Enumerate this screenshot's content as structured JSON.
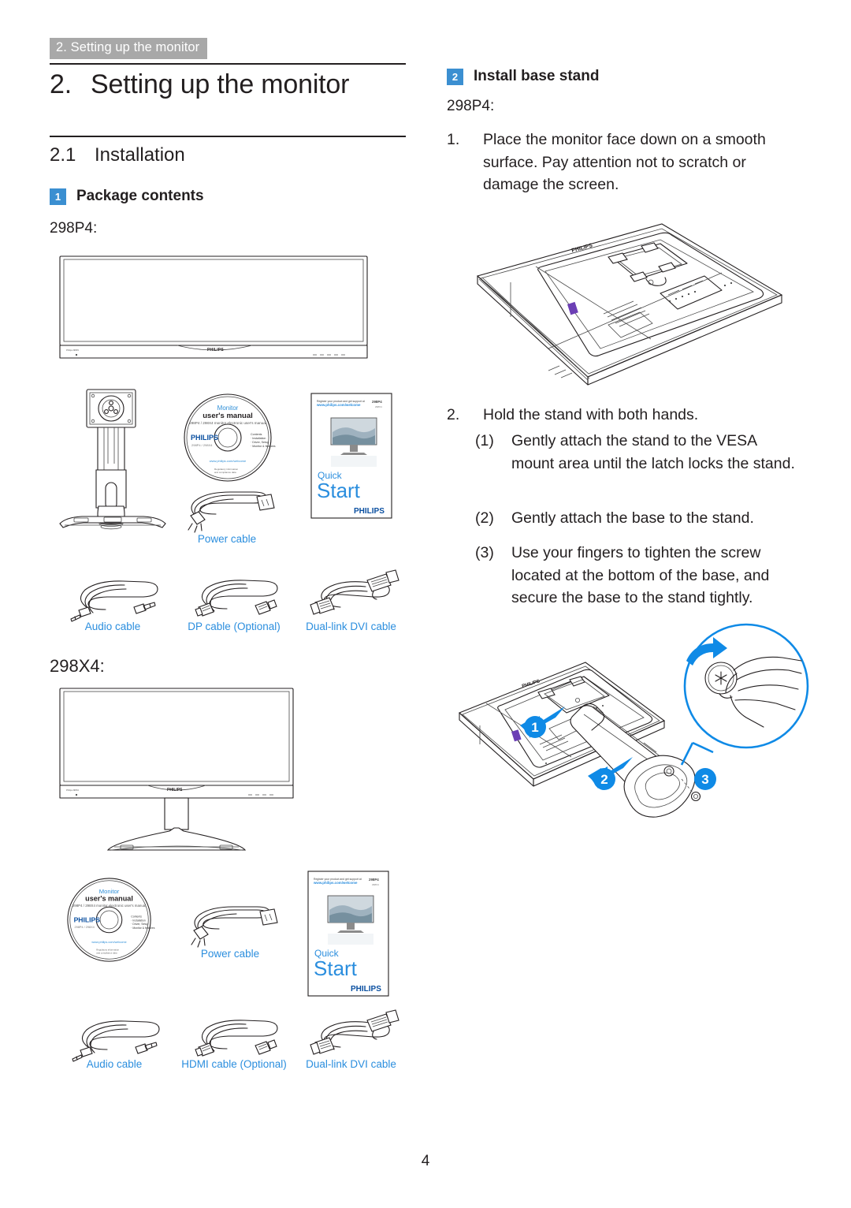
{
  "running_header": "2. Setting up the monitor",
  "chapter": {
    "number": "2.",
    "title": "Setting up the monitor"
  },
  "section": {
    "number": "2.1",
    "title": "Installation"
  },
  "page_number": "4",
  "colors": {
    "header_tab_bg": "#a8a8a8",
    "badge_blue": "#3b8fd1",
    "caption_blue": "#2b8ede",
    "artwork_blue": "#0f8ae6",
    "text": "#231f20"
  },
  "left_column": {
    "heading": {
      "badge": "1",
      "label": "Package contents"
    },
    "model_1": "298P4:",
    "model_2": "298X4:",
    "captions_298p4": [
      {
        "label": "Power cable",
        "name": "power-cable"
      },
      {
        "label": "Audio cable",
        "name": "audio-cable"
      },
      {
        "label": "DP cable (Optional)",
        "name": "dp-cable"
      },
      {
        "label": "Dual-link DVI cable",
        "name": "dvi-cable"
      }
    ],
    "captions_298x4": [
      {
        "label": "Power cable",
        "name": "power-cable"
      },
      {
        "label": "Audio cable",
        "name": "audio-cable"
      },
      {
        "label": "HDMI cable (Optional)",
        "name": "hdmi-cable"
      },
      {
        "label": "Dual-link DVI cable",
        "name": "dvi-cable"
      }
    ],
    "cd_disc": {
      "line1": "Monitor",
      "line2": "user's manual",
      "brand": "PHILIPS"
    },
    "quick_start_booklet": {
      "quick": "Quick",
      "start": "Start",
      "brand": "PHILIPS"
    },
    "monitor_brand": "PHILIPS"
  },
  "right_column": {
    "heading": {
      "badge": "2",
      "label": "Install base stand"
    },
    "model": "298P4:",
    "steps": [
      {
        "marker": "1.",
        "text": "Place the monitor face down on a smooth surface. Pay attention not to scratch or damage the screen."
      },
      {
        "marker": "2.",
        "text": "Hold the stand with both hands."
      }
    ],
    "substeps": [
      {
        "marker": "(1)",
        "text": "Gently attach the stand to the VESA mount area until the latch locks the stand."
      },
      {
        "marker": "(2)",
        "text": "Gently attach the base to the stand."
      },
      {
        "marker": "(3)",
        "text": "Use your fingers to tighten the screw located at the bottom of the base, and secure the base to the stand tightly."
      }
    ],
    "callouts": [
      "1",
      "2",
      "3"
    ],
    "monitor_brand": "PHILIPS"
  }
}
